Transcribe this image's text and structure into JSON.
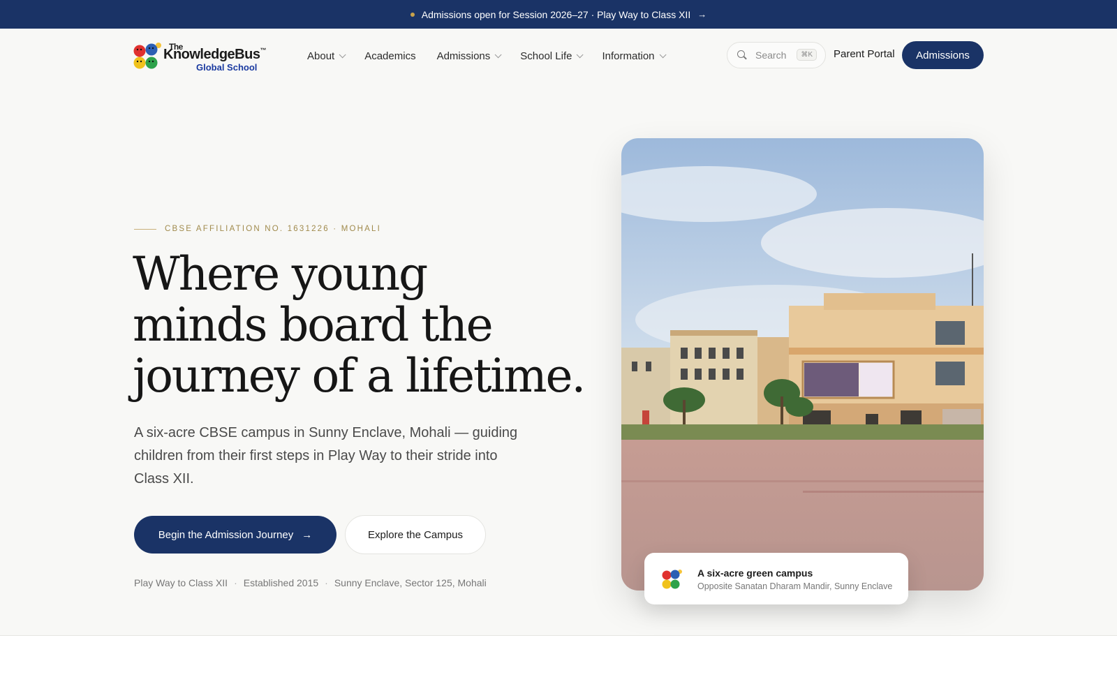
{
  "announcement": {
    "text": "Admissions open for Session 2026–27 · Play Way to Class XII",
    "arrow": "→"
  },
  "brand": {
    "the": "The",
    "name": "KnowledgeBus",
    "tm": "™",
    "subtitle": "Global School"
  },
  "nav": {
    "items": [
      {
        "label": "About",
        "has_dropdown": true
      },
      {
        "label": "Academics",
        "has_dropdown": false
      },
      {
        "label": "Admissions",
        "has_dropdown": true
      },
      {
        "label": "School Life",
        "has_dropdown": true
      },
      {
        "label": "Information",
        "has_dropdown": true
      }
    ]
  },
  "search": {
    "placeholder": "Search",
    "shortcut": "⌘K"
  },
  "header_actions": {
    "parent_portal": "Parent Portal",
    "admissions": "Admissions"
  },
  "hero": {
    "eyebrow": "CBSE AFFILIATION NO. 1631226 · MOHALI",
    "headline_lines": [
      "Where young",
      "minds board the",
      "journey of a lifetime."
    ],
    "lede": "A six-acre CBSE campus in Sunny Enclave, Mohali — guiding children from their first steps in Play Way to their stride into Class XII.",
    "cta_primary": "Begin the Admission Journey",
    "cta_primary_arrow": "→",
    "cta_secondary": "Explore the Campus",
    "facts": [
      "Play Way to Class XII",
      "Established 2015",
      "Sunny Enclave, Sector 125, Mohali"
    ],
    "fact_separator": "·"
  },
  "campus_card": {
    "title": "A six-acre green campus",
    "subtitle": "Opposite Sanatan Dharam Mandir, Sunny Enclave"
  },
  "colors": {
    "primary": "#1a3366",
    "accent_gold": "#a08a4c",
    "background": "#f8f8f6"
  }
}
